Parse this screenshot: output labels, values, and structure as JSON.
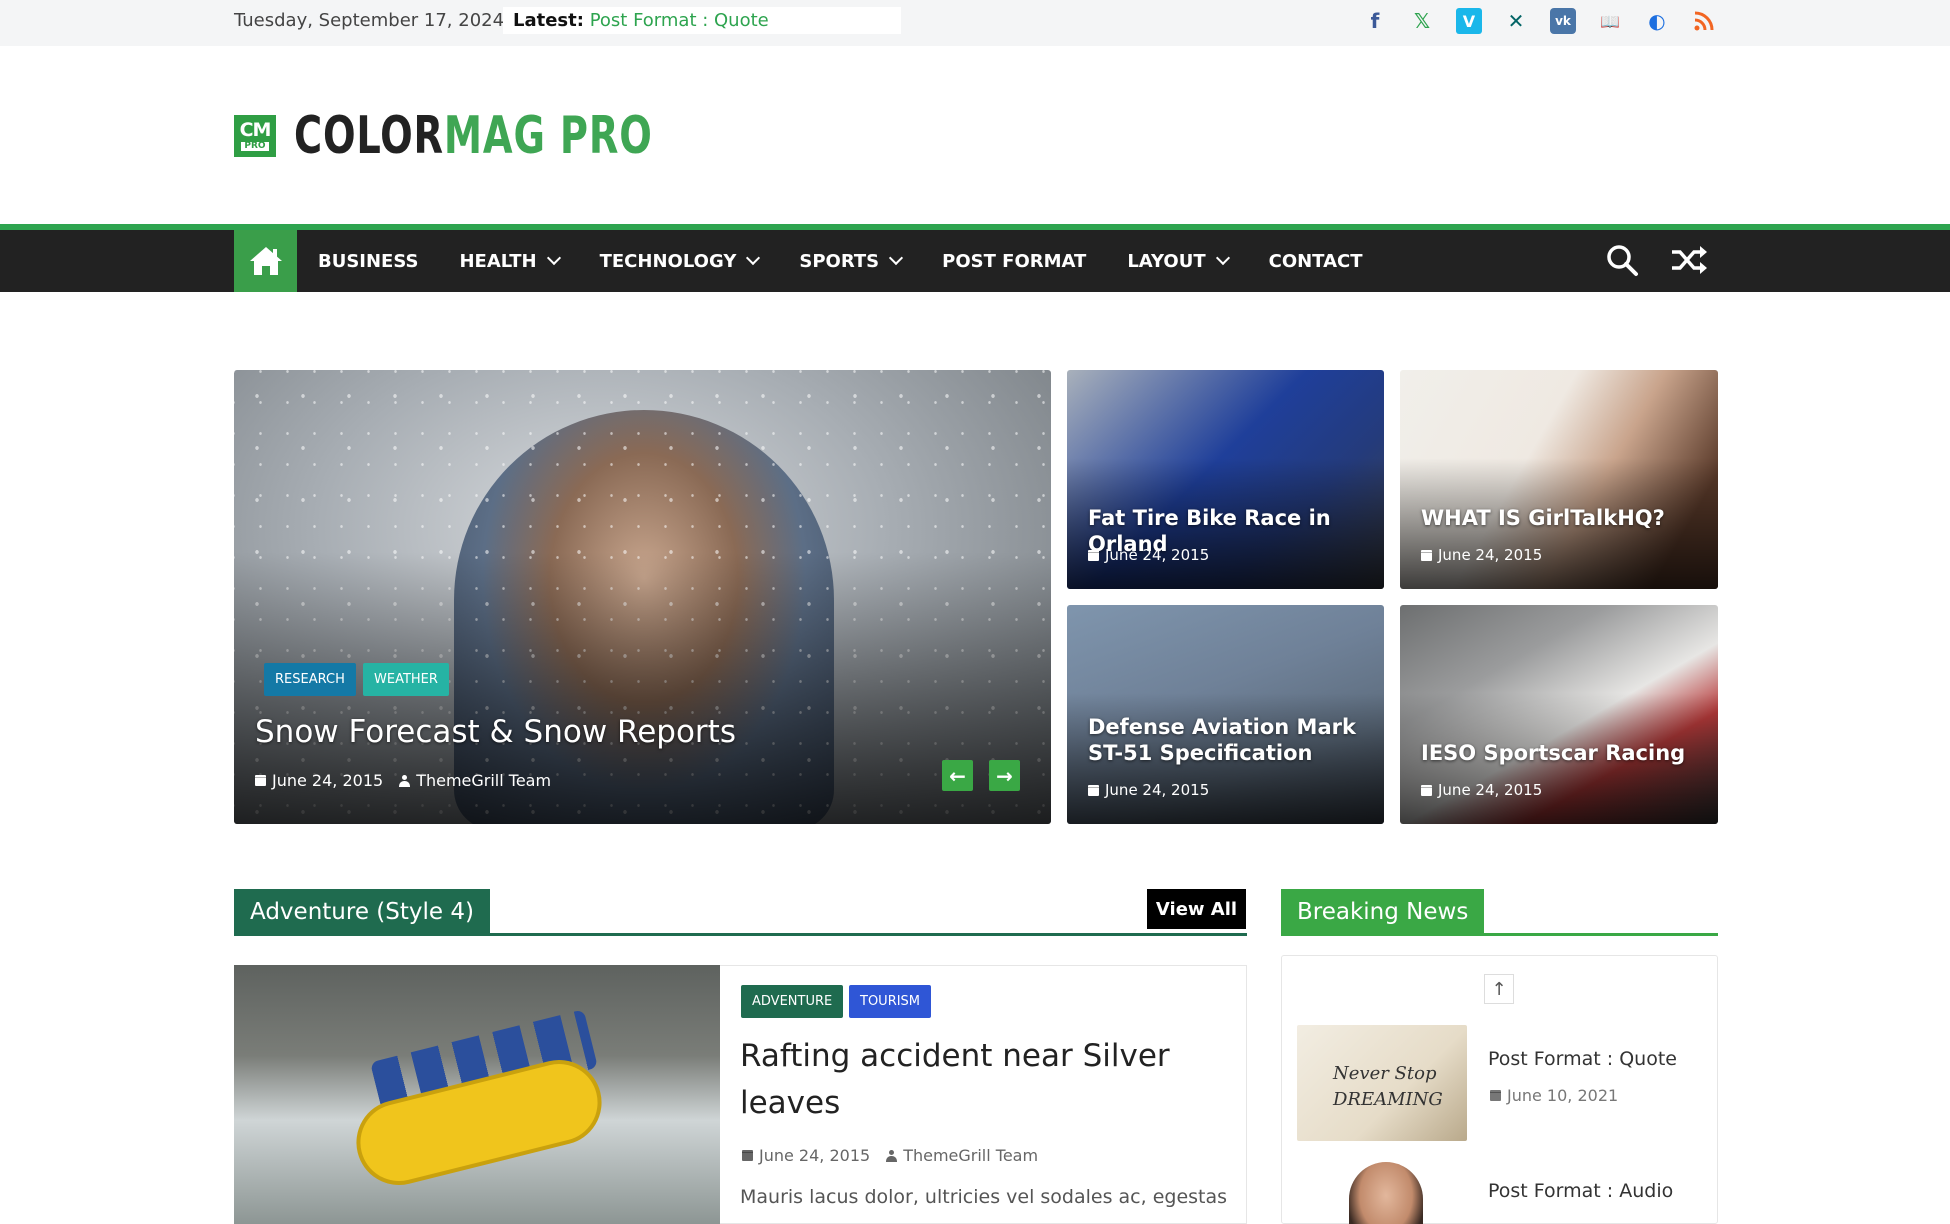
{
  "topbar": {
    "date": "Tuesday, September 17, 2024",
    "latest_label": "Latest:",
    "latest_value": "Post Format : Quote",
    "social": [
      {
        "icon": "facebook-icon",
        "glyph": "f",
        "color": "#3b5998"
      },
      {
        "icon": "x-twitter-icon",
        "glyph": "𝕏",
        "color": "#2ea44f"
      },
      {
        "icon": "vimeo-icon",
        "glyph": "V",
        "color": "#1ab7ea"
      },
      {
        "icon": "xing-icon",
        "glyph": "✕",
        "color": "#026466"
      },
      {
        "icon": "vk-icon",
        "glyph": "vk",
        "color": "#4a76a8"
      },
      {
        "icon": "book-icon",
        "glyph": "📖",
        "color": "#222222"
      },
      {
        "icon": "ello-icon",
        "glyph": "◐",
        "color": "#1d6fe0"
      },
      {
        "icon": "rss-icon",
        "glyph": "◝",
        "color": "#f26522"
      }
    ]
  },
  "logo": {
    "badge_top": "CM",
    "badge_bottom": "PRO",
    "text_a": "COLOR",
    "text_b": "MAG PRO"
  },
  "nav": {
    "items": [
      {
        "label": "BUSINESS",
        "dropdown": false
      },
      {
        "label": "HEALTH",
        "dropdown": true
      },
      {
        "label": "TECHNOLOGY",
        "dropdown": true
      },
      {
        "label": "SPORTS",
        "dropdown": true
      },
      {
        "label": "POST FORMAT",
        "dropdown": false
      },
      {
        "label": "LAYOUT",
        "dropdown": true
      },
      {
        "label": "CONTACT",
        "dropdown": false
      }
    ]
  },
  "featured": {
    "main": {
      "tags": [
        {
          "label": "RESEARCH",
          "color": "#1479a6"
        },
        {
          "label": "WEATHER",
          "color": "#26b3a4"
        }
      ],
      "title": "Snow Forecast & Snow Reports",
      "date": "June 24, 2015",
      "author": "ThemeGrill Team"
    },
    "small": [
      {
        "title": "Fat Tire Bike Race in Orland",
        "date": "June 24, 2015"
      },
      {
        "title": "WHAT IS GirlTalkHQ?",
        "date": "June 24, 2015"
      },
      {
        "title": "Defense Aviation Mark ST-51 Specification",
        "date": "June 24, 2015"
      },
      {
        "title": "IESO Sportscar Racing",
        "date": "June 24, 2015"
      }
    ]
  },
  "adventure": {
    "section_title": "Adventure (Style 4)",
    "view_all": "View All",
    "accent": "#1f6b4f",
    "tags": [
      {
        "label": "ADVENTURE",
        "color": "#1f6b4f"
      },
      {
        "label": "TOURISM",
        "color": "#2f56d6"
      }
    ],
    "title": "Rafting accident near Silver leaves",
    "date": "June 24, 2015",
    "author": "ThemeGrill Team",
    "excerpt": "Mauris lacus dolor, ultricies vel sodales ac, egestas"
  },
  "breaking": {
    "section_title": "Breaking News",
    "accent": "#3aa845",
    "thumb_text": "Never Stop DREAMING",
    "items": [
      {
        "title": "Post Format : Quote",
        "date": "June 10, 2021"
      },
      {
        "title": "Post Format : Audio"
      }
    ]
  }
}
